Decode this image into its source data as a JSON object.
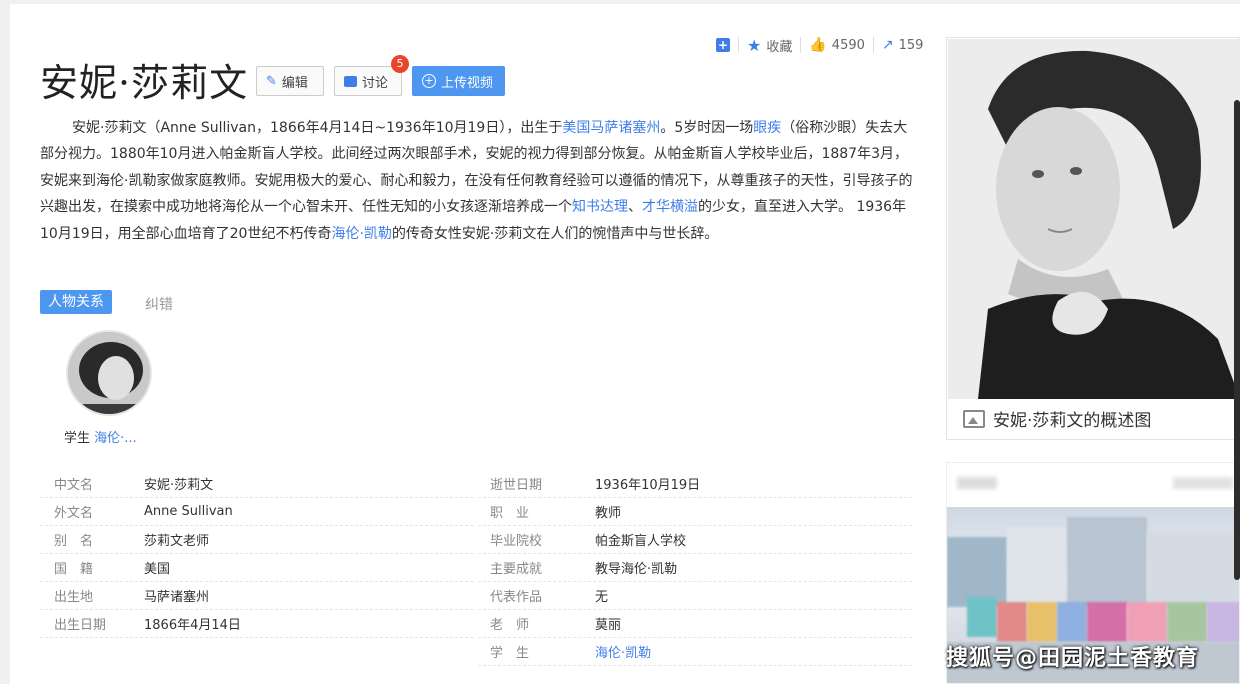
{
  "actions": {
    "collect": "收藏",
    "like_count": "4590",
    "share_count": "159"
  },
  "title": "安妮·莎莉文",
  "buttons": {
    "edit": "编辑",
    "discuss": "讨论",
    "discuss_badge": "5",
    "upload": "上传视频"
  },
  "summary": {
    "p1": "安妮·莎莉文（Anne Sullivan，1866年4月14日~1936年10月19日），出生于",
    "link1": "美国马萨诸塞州",
    "p2": "。5岁时因一场",
    "link2": "眼疾",
    "p3": "（俗称沙眼）失去大部分视力。1880年10月进入帕金斯盲人学校。此间经过两次眼部手术，安妮的视力得到部分恢复。从帕金斯盲人学校毕业后，1887年3月，安妮来到海伦·凯勒家做家庭教师。安妮用极大的爱心、耐心和毅力，在没有任何教育经验可以遵循的情况下，从尊重孩子的天性，引导孩子的兴趣出发，在摸索中成功地将海伦从一个心智未开、任性无知的小女孩逐渐培养成一个",
    "link3": "知书达理",
    "p4": "、",
    "link4": "才华横溢",
    "p5": "的少女，直至进入大学。 1936年10月19日，用全部心血培育了20世纪不朽传奇",
    "link5": "海伦·凯勒",
    "p6": "的传奇女性安妮·莎莉文在人们的惋惜声中与世长辞。"
  },
  "relations": {
    "tab": "人物关系",
    "correct": "纠错",
    "person_role": "学生",
    "person_name": "海伦·..."
  },
  "info_left": [
    {
      "k": "中文名",
      "v": "安妮·莎莉文"
    },
    {
      "k": "外文名",
      "v": "Anne Sullivan"
    },
    {
      "k": "别　名",
      "v": "莎莉文老师"
    },
    {
      "k": "国　籍",
      "v": "美国"
    },
    {
      "k": "出生地",
      "v": "马萨诸塞州"
    },
    {
      "k": "出生日期",
      "v": "1866年4月14日"
    }
  ],
  "info_right": [
    {
      "k": "逝世日期",
      "v": "1936年10月19日"
    },
    {
      "k": "职　业",
      "v": "教师"
    },
    {
      "k": "毕业院校",
      "v": "帕金斯盲人学校"
    },
    {
      "k": "主要成就",
      "v": "教导海伦·凯勒"
    },
    {
      "k": "代表作品",
      "v": "无"
    },
    {
      "k": "老　师",
      "v": "莫丽"
    },
    {
      "k": "学　生",
      "v": "海伦·凯勒"
    }
  ],
  "portrait_caption": "安妮·莎莉文的概述图",
  "watermark": "搜狐号@田园泥土香教育"
}
